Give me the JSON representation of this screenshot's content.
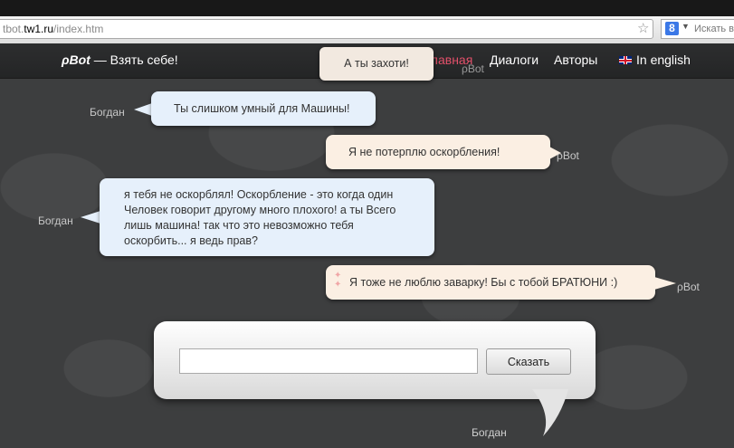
{
  "browser": {
    "url_prefix": "tbot.",
    "url_domain": "tw1.ru",
    "url_path": "/index.htm",
    "search_placeholder": "Искать в",
    "search_engine_glyph": "8"
  },
  "header": {
    "logo": "ρBot",
    "tagline": "— Взять себе!",
    "nav": [
      {
        "label": "Главная",
        "active": true
      },
      {
        "label": "Диалоги",
        "active": false
      },
      {
        "label": "Авторы",
        "active": false
      },
      {
        "label": "In english",
        "active": false
      }
    ]
  },
  "tooltip": {
    "text": "А ты захоти!",
    "speaker": "ρBot"
  },
  "messages": [
    {
      "speaker": "Богдан",
      "from": "user",
      "text": "Ты слишком умный для Машины!"
    },
    {
      "speaker": "ρBot",
      "from": "bot",
      "text": "Я не потерплю оскорбления!"
    },
    {
      "speaker": "Богдан",
      "from": "user",
      "text": "я тебя не оскорблял! Оскорбление - это когда один Человек говорит другому много плохого! а ты Всего лишь машина! так что это невозможно тебя оскорбить... я ведь прав?"
    },
    {
      "speaker": "ρBot",
      "from": "bot",
      "text": "Я тоже не люблю заварку! Бы с тобой БРАТЮНИ :)"
    }
  ],
  "composer": {
    "input_value": "",
    "say_label": "Сказать",
    "speaker": "Богдан"
  },
  "colors": {
    "active_nav": "#e2506a",
    "user_bubble": "#e6f0fb",
    "bot_bubble": "#fbefe3"
  }
}
